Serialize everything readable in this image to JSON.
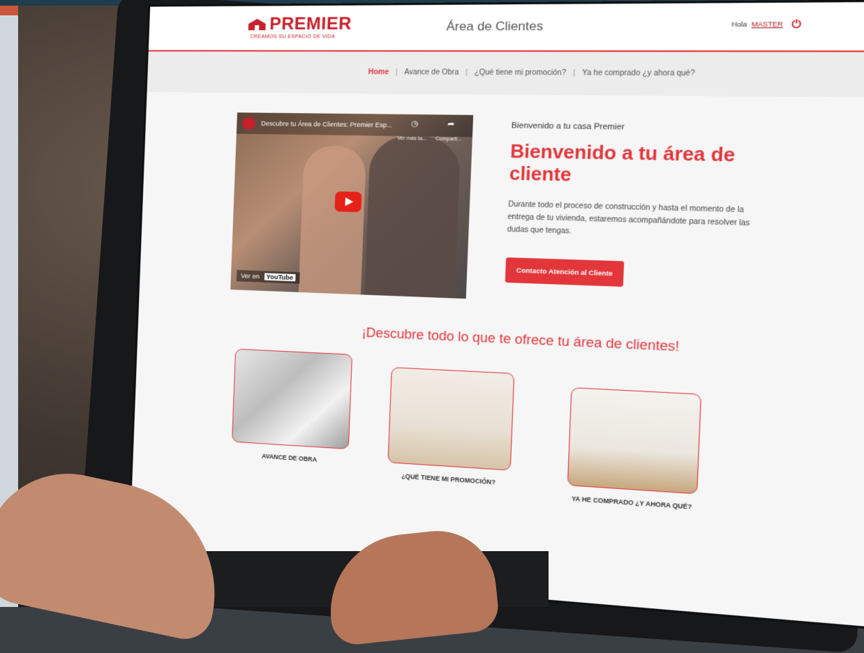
{
  "header": {
    "logo_text": "PREMIER",
    "logo_tagline": "CREAMOS SU ESPACIO DE VIDA",
    "area_title": "Área de Clientes",
    "greeting": "Hola",
    "user_name": "MASTER"
  },
  "nav": {
    "items": [
      {
        "label": "Home",
        "active": true
      },
      {
        "label": "Avance de Obra",
        "active": false
      },
      {
        "label": "¿Qué tiene mi promoción?",
        "active": false
      },
      {
        "label": "Ya he comprado ¿y ahora qué?",
        "active": false
      }
    ]
  },
  "video": {
    "title": "Descubre tu Área de Clientes: Premier Esp...",
    "watch_later": "Ver más ta...",
    "share": "Comparti...",
    "watch_on": "Ver en",
    "platform": "YouTube"
  },
  "hero": {
    "subtitle": "Bienvenido a tu casa Premier",
    "title": "Bienvenido a tu área de cliente",
    "body": "Durante todo el proceso de construcción y hasta el momento de la entrega de tu vivienda, estaremos acompañándote para resolver las dudas que tengas.",
    "cta_label": "Contacto Atención al Cliente"
  },
  "discover": {
    "heading": "¡Descubre todo lo que te ofrece tu área de clientes!",
    "cards": [
      {
        "label": "AVANCE DE OBRA"
      },
      {
        "label": "¿QUÉ TIENE MI PROMOCIÓN?"
      },
      {
        "label": "YA HE COMPRADO ¿Y AHORA QUÉ?"
      }
    ]
  },
  "colors": {
    "brand_red": "#e2363b",
    "nav_bg": "#ececec"
  }
}
